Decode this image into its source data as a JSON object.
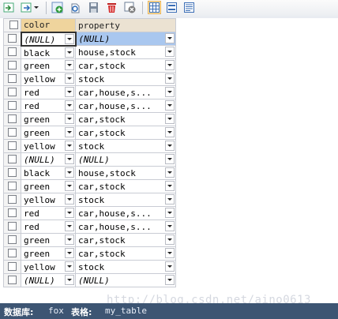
{
  "toolbar": {
    "buttons": [
      {
        "icon": "import-wizard-icon"
      },
      {
        "icon": "export-wizard-icon"
      },
      {
        "icon": "add-row-icon"
      },
      {
        "icon": "refresh-icon"
      },
      {
        "icon": "save-icon"
      },
      {
        "icon": "delete-row-icon"
      },
      {
        "icon": "cancel-icon"
      },
      {
        "icon": "grid-view-icon",
        "active": true
      },
      {
        "icon": "form-view-icon"
      },
      {
        "icon": "text-view-icon"
      }
    ]
  },
  "grid": {
    "columns": [
      "color",
      "property"
    ],
    "rows": [
      {
        "color": "(NULL)",
        "property": "(NULL)"
      },
      {
        "color": "black",
        "property": "house,stock"
      },
      {
        "color": "green",
        "property": "car,stock"
      },
      {
        "color": "yellow",
        "property": "stock"
      },
      {
        "color": "red",
        "property": "car,house,s..."
      },
      {
        "color": "red",
        "property": "car,house,s..."
      },
      {
        "color": "green",
        "property": "car,stock"
      },
      {
        "color": "green",
        "property": "car,stock"
      },
      {
        "color": "yellow",
        "property": "stock"
      },
      {
        "color": "(NULL)",
        "property": "(NULL)"
      },
      {
        "color": "black",
        "property": "house,stock"
      },
      {
        "color": "green",
        "property": "car,stock"
      },
      {
        "color": "yellow",
        "property": "stock"
      },
      {
        "color": "red",
        "property": "car,house,s..."
      },
      {
        "color": "red",
        "property": "car,house,s..."
      },
      {
        "color": "green",
        "property": "car,stock"
      },
      {
        "color": "green",
        "property": "car,stock"
      },
      {
        "color": "yellow",
        "property": "stock"
      },
      {
        "color": "(NULL)",
        "property": "(NULL)"
      }
    ]
  },
  "status": {
    "db_label": "数据库:",
    "db_value": "fox",
    "table_label": "表格:",
    "table_value": "my_table"
  },
  "watermark": "http://blog.csdn.net/aino0613"
}
